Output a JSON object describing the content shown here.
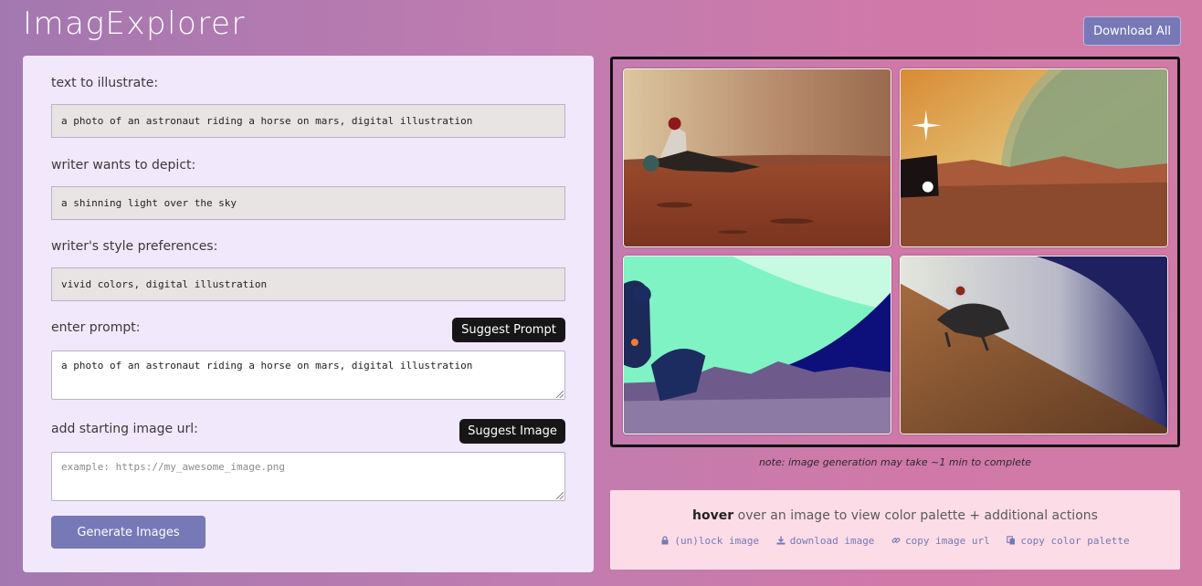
{
  "app": {
    "title": "ImagExplorer"
  },
  "toolbar": {
    "download_all_label": "Download All"
  },
  "form": {
    "text_label": "text to illustrate:",
    "text_value": "a photo of an astronaut riding a horse on mars, digital illustration",
    "depict_label": "writer wants to depict:",
    "depict_value": "a shinning light over the sky",
    "style_label": "writer's style preferences:",
    "style_value": "vivid colors, digital illustration",
    "prompt_label": "enter prompt:",
    "suggest_prompt_label": "Suggest Prompt",
    "prompt_value": "a photo of an astronaut riding a horse on mars, digital illustration",
    "image_url_label": "add starting image url:",
    "suggest_image_label": "Suggest Image",
    "image_url_placeholder": "example: https://my_awesome_image.png",
    "generate_label": "Generate Images"
  },
  "gallery": {
    "note": "note: image generation may take ~1 min to complete",
    "images": [
      {
        "alt": "astronaut on horse on mars, hazy sky"
      },
      {
        "alt": "mars landscape with glowing planet and star flare"
      },
      {
        "alt": "cyan sky astronaut silhouette over purple hills"
      },
      {
        "alt": "astronaut riding horse on sloped mars dune"
      }
    ]
  },
  "info": {
    "hover_bold": "hover",
    "hover_rest": " over an image to view color palette + additional actions",
    "actions": [
      {
        "icon": "lock-icon",
        "label": "(un)lock image"
      },
      {
        "icon": "download-icon",
        "label": "download image"
      },
      {
        "icon": "link-icon",
        "label": "copy image url"
      },
      {
        "icon": "copy-icon",
        "label": "copy color palette"
      }
    ]
  },
  "colors": {
    "accent": "#7679b6",
    "panel_bg": "#f1e8fb",
    "info_bg": "#fcdde7",
    "dark_button": "#161616"
  }
}
